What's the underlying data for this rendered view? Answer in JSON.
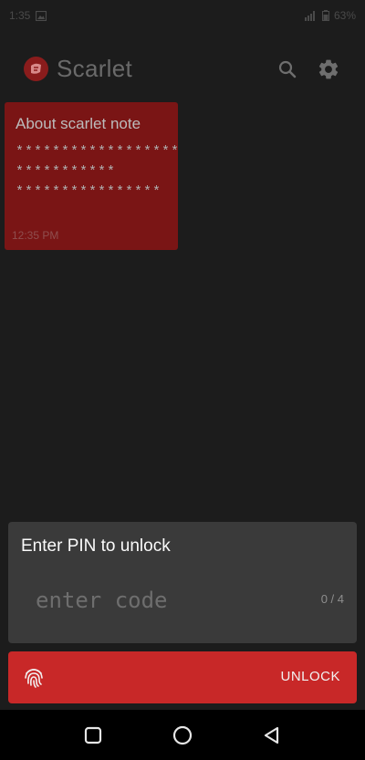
{
  "status_bar": {
    "time": "1:35",
    "battery": "63%"
  },
  "app_bar": {
    "title": "Scarlet"
  },
  "note": {
    "title": "About scarlet note",
    "body": "******************\n***********\n****************",
    "time": "12:35 PM"
  },
  "pin_panel": {
    "label": "Enter PIN to unlock",
    "placeholder": "enter code",
    "counter": "0 / 4"
  },
  "unlock_button": {
    "label": "UNLOCK"
  },
  "colors": {
    "background": "#1c1c1c",
    "note_card": "#7a1515",
    "panel": "#3a3a3a",
    "accent": "#c82828"
  }
}
